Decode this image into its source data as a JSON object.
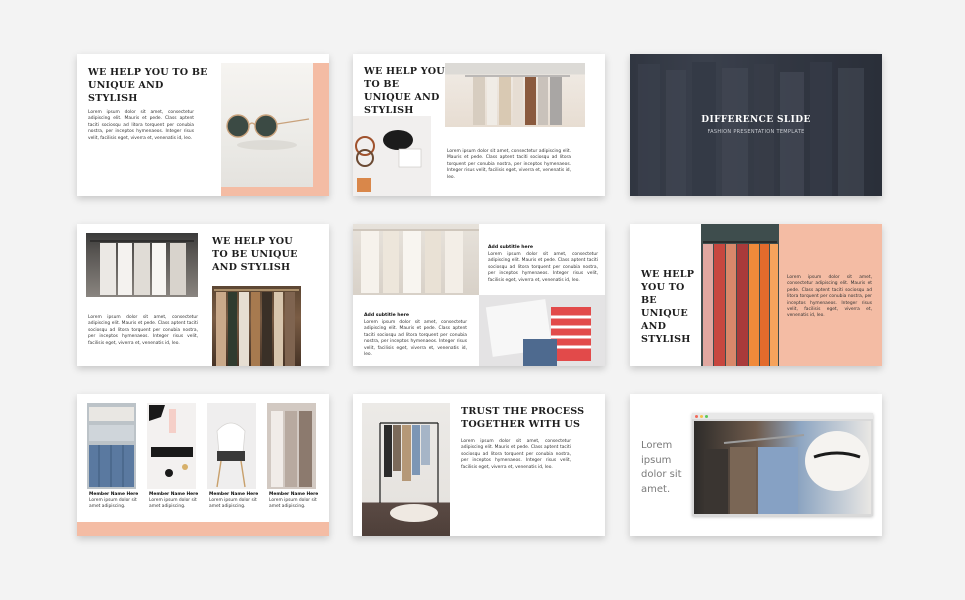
{
  "slides": {
    "s1": {
      "title": "WE HELP YOU TO BE UNIQUE AND STYLISH",
      "body": "Lorem ipsum dolor sit amet, consectetur adipiscing elit. Mauris et pede. Class aptent taciti sociosqu ad litora torquent per conubia nostra, per inceptos hymenaeos. Integer risus velit, facilisis eget, viverra et, venenatis id, leo."
    },
    "s2": {
      "title": "WE HELP YOU TO BE UNIQUE AND STYLISH",
      "body": "Lorem ipsum dolor sit amet, consectetur adipiscing elit. Mauris et pede. Class aptent taciti sociosqu ad litora torquent per conubia nostra, per inceptos hymenaeos. Integer risus velit, facilisis eget, viverra et, venenatis id, leo."
    },
    "s3": {
      "title": "DIFFERENCE SLIDE",
      "subtitle": "FASHION PRESENTATION TEMPLATE"
    },
    "s4": {
      "title": "WE HELP YOU TO BE UNIQUE AND STYLISH",
      "body": "Lorem ipsum dolor sit amet, consectetur adipiscing elit. Mauris et pede. Class aptent taciti sociosqu ad litora torquent per conubia nostra, per inceptos hymenaeos. Integer risus velit, facilisis eget, viverra et, venenatis id, leo."
    },
    "s5": {
      "subtitle_1": "Add subtitle here",
      "body_1": "Lorem ipsum dolor sit amet, consectetur adipiscing elit. Mauris et pede. Class aptent taciti sociosqu ad litora torquent per conubia nostra, per inceptos hymenaeos. Integer risus velit, facilisis eget, viverra et, venenatis id, leo.",
      "subtitle_2": "Add subtitle here",
      "body_2": "Lorem ipsum dolor sit amet, consectetur adipiscing elit. Mauris et pede. Class aptent taciti sociosqu ad litora torquent per conubia nostra, per inceptos hymenaeos. Integer risus velit, facilisis eget, viverra et, venenatis id, leo."
    },
    "s6": {
      "title": "WE HELP YOU TO BE UNIQUE AND STYLISH",
      "body": "Lorem ipsum dolor sit amet, consectetur adipiscing elit. Mauris et pede. Class aptent taciti sociosqu ad litora torquent per conubia nostra, per inceptos hymenaeos. Integer risus velit, facilisis eget, viverra et, venenatis id, leo."
    },
    "s7": {
      "members": [
        {
          "name": "Member Name Here",
          "desc": "Lorem ipsum dolor sit amet adipiscing."
        },
        {
          "name": "Member Name Here",
          "desc": "Lorem ipsum dolor sit amet adipiscing."
        },
        {
          "name": "Member Name Here",
          "desc": "Lorem ipsum dolor sit amet adipiscing."
        },
        {
          "name": "Member Name Here",
          "desc": "Lorem ipsum dolor sit amet adipiscing."
        }
      ]
    },
    "s8": {
      "title": "TRUST THE PROCESS TOGETHER WITH US",
      "body": "Lorem ipsum dolor sit amet, consectetur adipiscing elit. Mauris et pede. Class aptent taciti sociosqu ad litora torquent per conubia nostra, per inceptos hymenaeos. Integer risus velit, facilisis eget, viverra et, venenatis id, leo."
    },
    "s9": {
      "text": "Lorem ipsum dolor sit amet."
    }
  },
  "colors": {
    "background": "#f3f3f3",
    "accent_peach": "#f4bca4",
    "dark_overlay": "#2f3440",
    "text_dark": "#1e1e1e"
  }
}
